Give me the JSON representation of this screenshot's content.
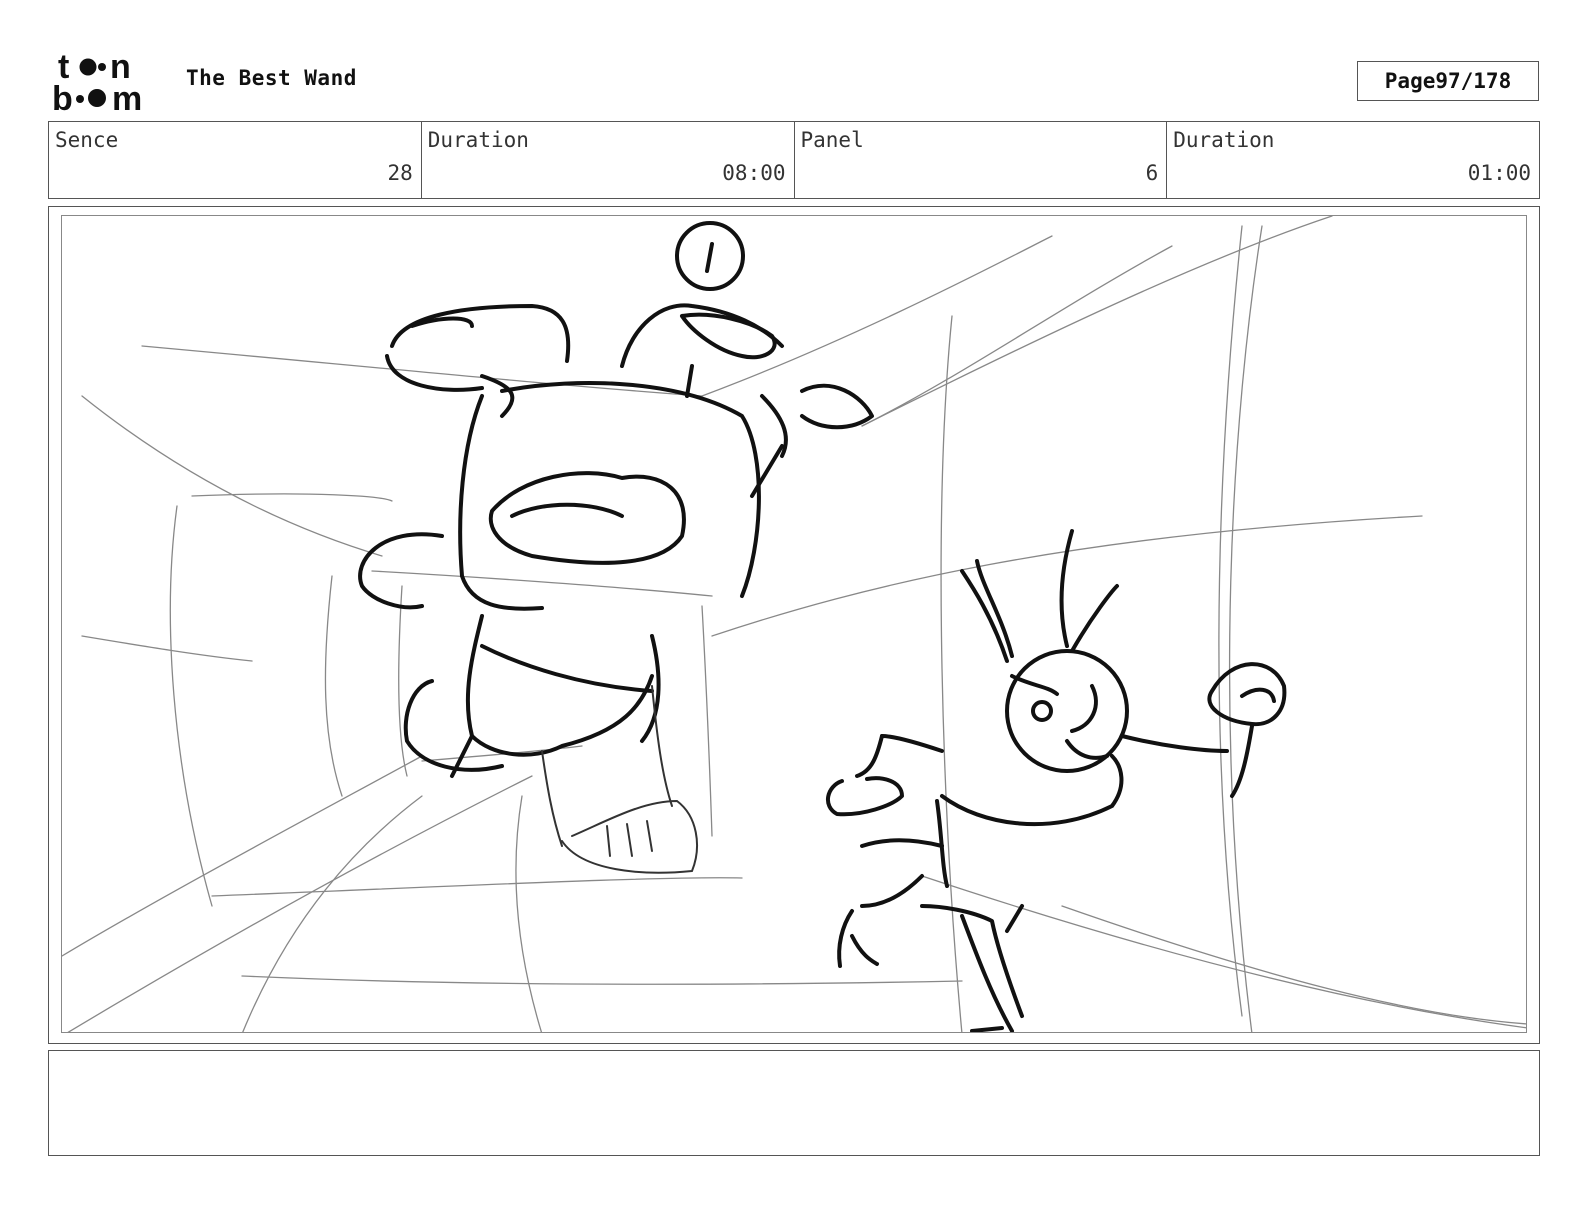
{
  "header": {
    "logo_text_top": "toon",
    "logo_text_bottom": "boom",
    "title": "The Best Wand",
    "page_label": "Page",
    "page_value": "97/178"
  },
  "info": {
    "scene_label": "Sence",
    "scene_value": "28",
    "scene_duration_label": "Duration",
    "scene_duration_value": "08:00",
    "panel_label": "Panel",
    "panel_value": "6",
    "panel_duration_label": "Duration",
    "panel_duration_value": "01:00"
  },
  "notes": {
    "text": ""
  }
}
